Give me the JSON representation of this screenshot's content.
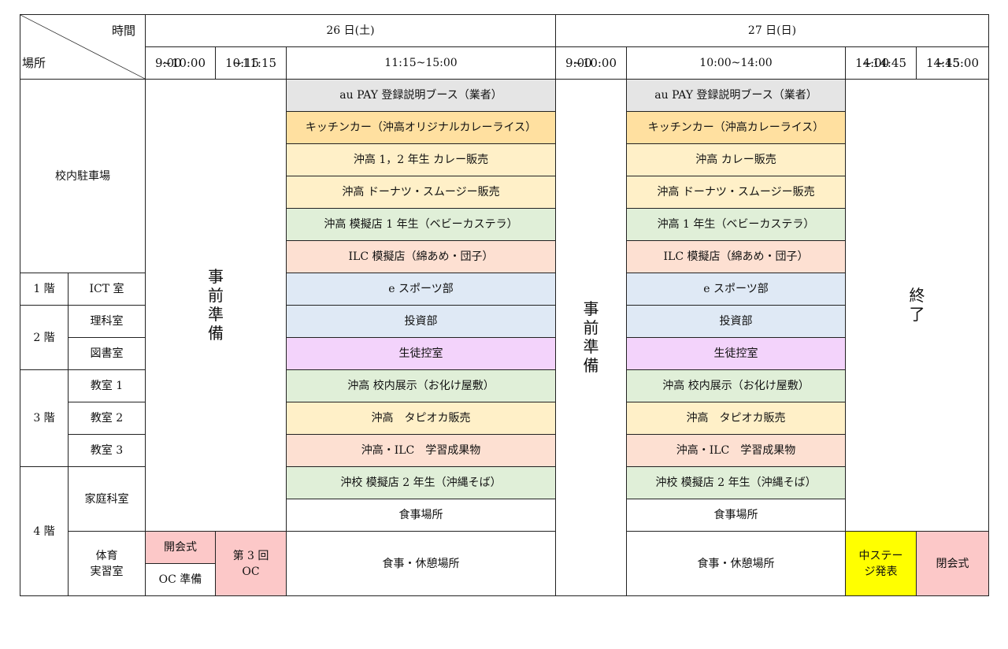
{
  "corner": {
    "time_label": "時間",
    "place_label": "場所"
  },
  "days": {
    "sat": "26 日(土)",
    "sun": "27 日(日)"
  },
  "times": {
    "sat_1_start": "9:00",
    "sat_1_end": "~10:00",
    "sat_2_start": "10:15",
    "sat_2_end": "~11:15",
    "sat_3": "11:15~15:00",
    "sun_1_start": "9:00",
    "sun_1_end": "~10:00",
    "sun_2": "10:00~14:00",
    "sun_3_start": "14:00",
    "sun_3_end": "~14:45",
    "sun_4_start": "14:45",
    "sun_4_end": "~15:00"
  },
  "places": {
    "parking": "校内駐車場",
    "f1": "1 階",
    "ict": "ICT 室",
    "f2": "2 階",
    "science": "理科室",
    "library": "図書室",
    "f3": "3 階",
    "room1": "教室 1",
    "room2": "教室 2",
    "room3": "教室 3",
    "f4": "4 階",
    "home_ec": "家庭科室",
    "gym_1": "体育",
    "gym_2": "実習室"
  },
  "prep_chars": [
    "事",
    "前",
    "準",
    "備"
  ],
  "end_chars": [
    "終",
    "了"
  ],
  "sat_events": [
    "au PAY 登録説明ブース（業者）",
    "キッチンカー（沖高オリジナルカレーライス）",
    "沖高 1，2 年生 カレー販売",
    "沖高 ドーナツ・スムージー販売",
    "沖高 模擬店 1 年生（ベビーカステラ）",
    "ILC 模擬店（綿あめ・団子）",
    "e スポーツ部",
    "投資部",
    "生徒控室",
    "沖高 校内展示（お化け屋敷）",
    "沖高　タピオカ販売",
    "沖高・ILC　学習成果物",
    "沖校 模擬店 2 年生（沖縄そば）",
    "食事場所",
    "食事・休憩場所"
  ],
  "sun_events": [
    "au PAY 登録説明ブース（業者）",
    "キッチンカー（沖高カレーライス）",
    "沖高 カレー販売",
    "沖高 ドーナツ・スムージー販売",
    "沖高 1 年生（ベビーカステラ）",
    "ILC 模擬店（綿あめ・団子）",
    "e スポーツ部",
    "投資部",
    "生徒控室",
    "沖高 校内展示（お化け屋敷）",
    "沖高　タピオカ販売",
    "沖高・ILC　学習成果物",
    "沖校 模擬店 2 年生（沖縄そば）",
    "食事場所",
    "食事・休憩場所"
  ],
  "gym_special": {
    "opening": "開会式",
    "oc_prep": "OC 準備",
    "oc_3_line1": "第 3 回",
    "oc_3_line2": "OC",
    "mid_stage_line1": "中ステー",
    "mid_stage_line2": "ジ発表",
    "closing": "閉会式"
  },
  "colors": {
    "gray": "#e5e5e5",
    "orange": "#ffe0a0",
    "cream": "#fff0c8",
    "green": "#e0efd8",
    "salmon": "#fde0d2",
    "blue": "#dfe9f5",
    "purple": "#f3d3fb",
    "pink": "#fcc8c8",
    "yellow": "#ffff00"
  }
}
